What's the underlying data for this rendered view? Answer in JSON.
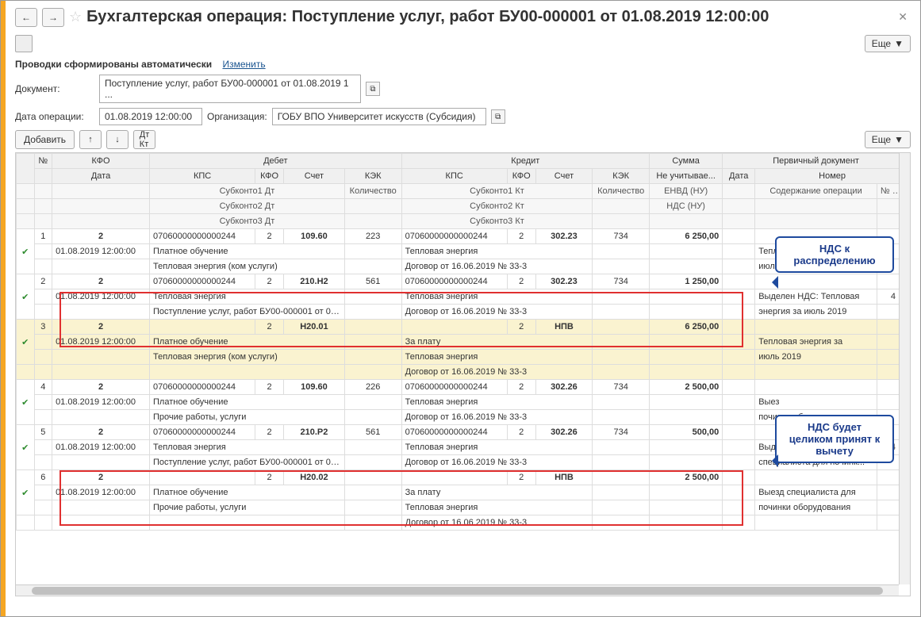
{
  "title": "Бухгалтерская операция: Поступление услуг, работ БУ00-000001 от 01.08.2019 12:00:00",
  "esche": "Еще",
  "subtitle": "Проводки сформированы автоматически",
  "change_link": "Изменить",
  "labels": {
    "document": "Документ:",
    "op_date": "Дата операции:",
    "org": "Организация:",
    "add": "Добавить"
  },
  "values": {
    "document": "Поступление услуг, работ БУ00-000001 от 01.08.2019 1 ...",
    "op_date": "01.08.2019 12:00:00",
    "org": "ГОБУ ВПО Университет искусств (Субсидия)"
  },
  "headers": {
    "num": "№",
    "kfo": "КФО",
    "debit": "Дебет",
    "credit": "Кредит",
    "sum": "Сумма",
    "primary": "Первичный документ",
    "date": "Дата",
    "kps": "КПС",
    "schet": "Счет",
    "kek": "КЭК",
    "neuch": "Не учитывае...",
    "number": "Номер",
    "sub1d": "Субконто1 Дт",
    "sub2d": "Субконто2 Дт",
    "sub3d": "Субконто3 Дт",
    "sub1k": "Субконто1 Кт",
    "sub2k": "Субконто2 Кт",
    "sub3k": "Субконто3 Кт",
    "qty": "Количество",
    "envd": "ЕНВД (НУ)",
    "nds": "НДС (НУ)",
    "content": "Содержание операции",
    "jo": "№ Ж/О"
  },
  "rows": [
    {
      "num": "1",
      "kfo": "2",
      "date": "01.08.2019 12:00:00",
      "d_kps": "07060000000000244",
      "d_kfo": "2",
      "d_schet": "109.60",
      "d_kek": "223",
      "d_s1": "Платное обучение",
      "d_s2": "Тепловая энергия (ком услуги)",
      "d_s3": "",
      "k_kps": "07060000000000244",
      "k_kfo": "2",
      "k_schet": "302.23",
      "k_kek": "734",
      "k_s1": "Тепловая энергия",
      "k_s2": "Договор от 16.06.2019 № 33-3",
      "k_s3": "",
      "sum": "6 250,00",
      "content": "Тепл",
      "content2": "июль 201",
      "jo": ""
    },
    {
      "num": "2",
      "kfo": "2",
      "date": "01.08.2019 12:00:00",
      "d_kps": "07060000000000244",
      "d_kfo": "2",
      "d_schet": "210.Н2",
      "d_kek": "561",
      "d_s1": "Тепловая энергия",
      "d_s2": "Поступление услуг, работ БУ00-000001 от 01.0...",
      "d_s3": "",
      "k_kps": "07060000000000244",
      "k_kfo": "2",
      "k_schet": "302.23",
      "k_kek": "734",
      "k_s1": "Тепловая энергия",
      "k_s2": "Договор от 16.06.2019 № 33-3",
      "k_s3": "",
      "sum": "1 250,00",
      "content": "Выделен НДС: Тепловая",
      "content2": "энергия за июль 2019",
      "jo": "4"
    },
    {
      "num": "3",
      "kfo": "2",
      "date": "01.08.2019 12:00:00",
      "d_kps": "",
      "d_kfo": "2",
      "d_schet": "Н20.01",
      "d_kek": "",
      "d_s1": "Платное обучение",
      "d_s2": "Тепловая энергия (ком услуги)",
      "d_s3": "",
      "k_kps": "",
      "k_kfo": "2",
      "k_schet": "НПВ",
      "k_kek": "",
      "k_s1": "За плату",
      "k_s2": "Тепловая энергия",
      "k_s3": "Договор от 16.06.2019 № 33-3",
      "sum": "6 250,00",
      "content": "Тепловая энергия за",
      "content2": "июль 2019",
      "jo": "",
      "yellow": true
    },
    {
      "num": "4",
      "kfo": "2",
      "date": "01.08.2019 12:00:00",
      "d_kps": "07060000000000244",
      "d_kfo": "2",
      "d_schet": "109.60",
      "d_kek": "226",
      "d_s1": "Платное обучение",
      "d_s2": "Прочие работы, услуги",
      "d_s3": "",
      "k_kps": "07060000000000244",
      "k_kfo": "2",
      "k_schet": "302.26",
      "k_kek": "734",
      "k_s1": "Тепловая энергия",
      "k_s2": "Договор от 16.06.2019 № 33-3",
      "k_s3": "",
      "sum": "2 500,00",
      "content": "Выез",
      "content2": "починки оборудования",
      "jo": ""
    },
    {
      "num": "5",
      "kfo": "2",
      "date": "01.08.2019 12:00:00",
      "d_kps": "07060000000000244",
      "d_kfo": "2",
      "d_schet": "210.Р2",
      "d_kek": "561",
      "d_s1": "Тепловая энергия",
      "d_s2": "Поступление услуг, работ БУ00-000001 от 01.0...",
      "d_s3": "",
      "k_kps": "07060000000000244",
      "k_kfo": "2",
      "k_schet": "302.26",
      "k_kek": "734",
      "k_s1": "Тепловая энергия",
      "k_s2": "Договор от 16.06.2019 № 33-3",
      "k_s3": "",
      "sum": "500,00",
      "content": "Выделен НДС: Выезд",
      "content2": "специалиста для починк...",
      "jo": "4"
    },
    {
      "num": "6",
      "kfo": "2",
      "date": "01.08.2019 12:00:00",
      "d_kps": "",
      "d_kfo": "2",
      "d_schet": "Н20.02",
      "d_kek": "",
      "d_s1": "Платное обучение",
      "d_s2": "Прочие работы, услуги",
      "d_s3": "",
      "k_kps": "",
      "k_kfo": "2",
      "k_schet": "НПВ",
      "k_kek": "",
      "k_s1": "За плату",
      "k_s2": "Тепловая энергия",
      "k_s3": "Договор от 16.06.2019 № 33-3",
      "sum": "2 500,00",
      "content": "Выезд специалиста для",
      "content2": "починки оборудования",
      "jo": ""
    }
  ],
  "callouts": {
    "c1": "НДС к распределению",
    "c2": "НДС будет целиком принят к вычету"
  }
}
